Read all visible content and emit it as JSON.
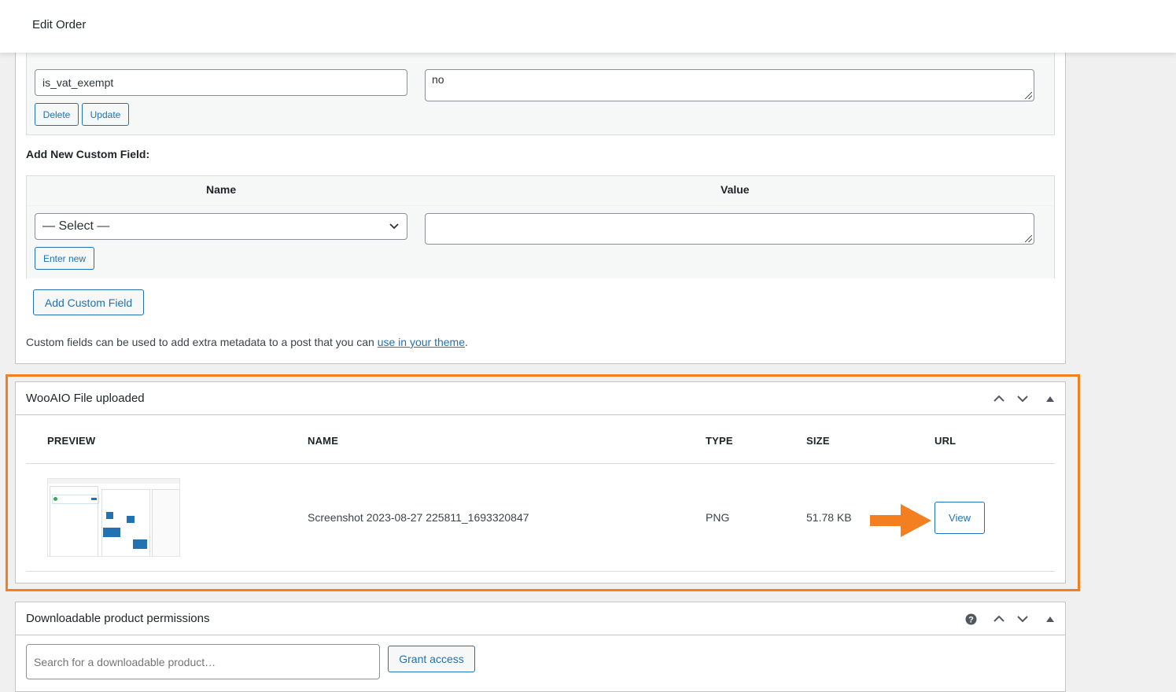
{
  "page": {
    "title": "Edit Order"
  },
  "custom_fields": {
    "existing": {
      "name_value": "is_vat_exempt",
      "value_value": "no",
      "delete_label": "Delete",
      "update_label": "Update"
    },
    "add_new_heading": "Add New Custom Field:",
    "name_header": "Name",
    "value_header": "Value",
    "select_value": "— Select —",
    "value_input": "",
    "enter_new_label": "Enter new",
    "add_button_label": "Add Custom Field",
    "note_prefix": "Custom fields can be used to add extra metadata to a post that you can ",
    "note_link": "use in your theme",
    "note_suffix": "."
  },
  "files_panel": {
    "title": "WooAIO File uploaded",
    "columns": [
      "PREVIEW",
      "NAME",
      "TYPE",
      "SIZE",
      "URL"
    ],
    "row": {
      "name": "Screenshot 2023-08-27 225811_1693320847",
      "type": "PNG",
      "size": "51.78 KB",
      "view_label": "View"
    },
    "highlight_color": "#f47f20",
    "arrow_color": "#f47f20"
  },
  "downloads_panel": {
    "title": "Downloadable product permissions",
    "search_placeholder": "Search for a downloadable product…",
    "grant_label": "Grant access"
  },
  "colors": {
    "accent": "#2271b1",
    "border": "#c3c4c7"
  }
}
